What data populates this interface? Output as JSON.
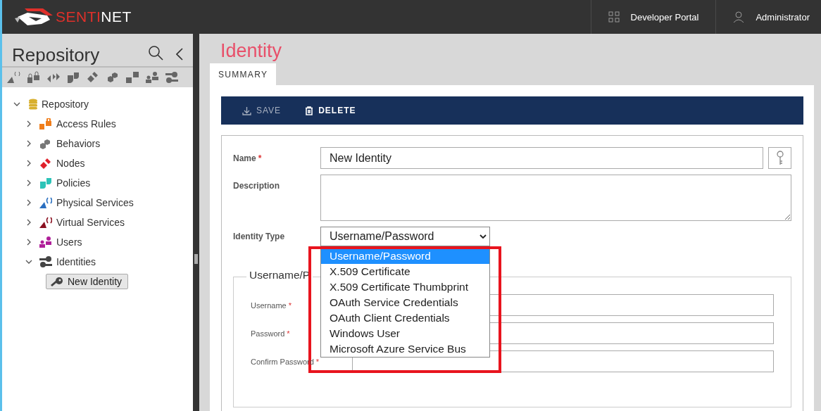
{
  "header": {
    "brand_1": "SENTI",
    "brand_2": "NET",
    "nav": [
      {
        "label": "Developer Portal"
      },
      {
        "label": "Administrator"
      }
    ]
  },
  "sidebar": {
    "title": "Repository",
    "tree": {
      "label": "Repository",
      "expanded": true,
      "children": [
        {
          "label": "Access Rules",
          "expanded": false
        },
        {
          "label": "Behaviors",
          "expanded": false
        },
        {
          "label": "Nodes",
          "expanded": false
        },
        {
          "label": "Policies",
          "expanded": false
        },
        {
          "label": "Physical Services",
          "expanded": false
        },
        {
          "label": "Virtual Services",
          "expanded": false
        },
        {
          "label": "Users",
          "expanded": false
        },
        {
          "label": "Identities",
          "expanded": true,
          "children": [
            {
              "label": "New Identity",
              "selected": true
            }
          ]
        }
      ]
    }
  },
  "page": {
    "title": "Identity",
    "tabs": [
      {
        "label": "SUMMARY",
        "selected": true
      }
    ],
    "toolbar": [
      {
        "label": "SAVE",
        "disabled": true
      },
      {
        "label": "DELETE",
        "disabled": false
      }
    ],
    "name": {
      "label": "Name",
      "required_mark": "*",
      "value": "New Identity"
    },
    "description": {
      "label": "Description"
    },
    "identity_type": {
      "label": "Identity Type",
      "value": "Username/Password",
      "expanded": true,
      "options": [
        {
          "label": "Username/Password",
          "selected": true
        },
        {
          "label": "X.509 Certificate",
          "selected": false
        },
        {
          "label": "X.509 Certificate Thumbprint",
          "selected": false
        },
        {
          "label": "OAuth Service Credentials",
          "selected": false
        },
        {
          "label": "OAuth Client Credentials",
          "selected": false
        },
        {
          "label": "Windows User",
          "selected": false
        },
        {
          "label": "Microsoft Azure Service Bus",
          "selected": false
        }
      ]
    },
    "credentials": {
      "legend": "Username/P",
      "fields": [
        {
          "label": "Username",
          "required_mark": "*"
        },
        {
          "label": "Password",
          "required_mark": "*"
        },
        {
          "label": "Confirm Password",
          "required_mark": "*"
        }
      ]
    }
  },
  "annotation": {
    "kind": "rectangle"
  }
}
